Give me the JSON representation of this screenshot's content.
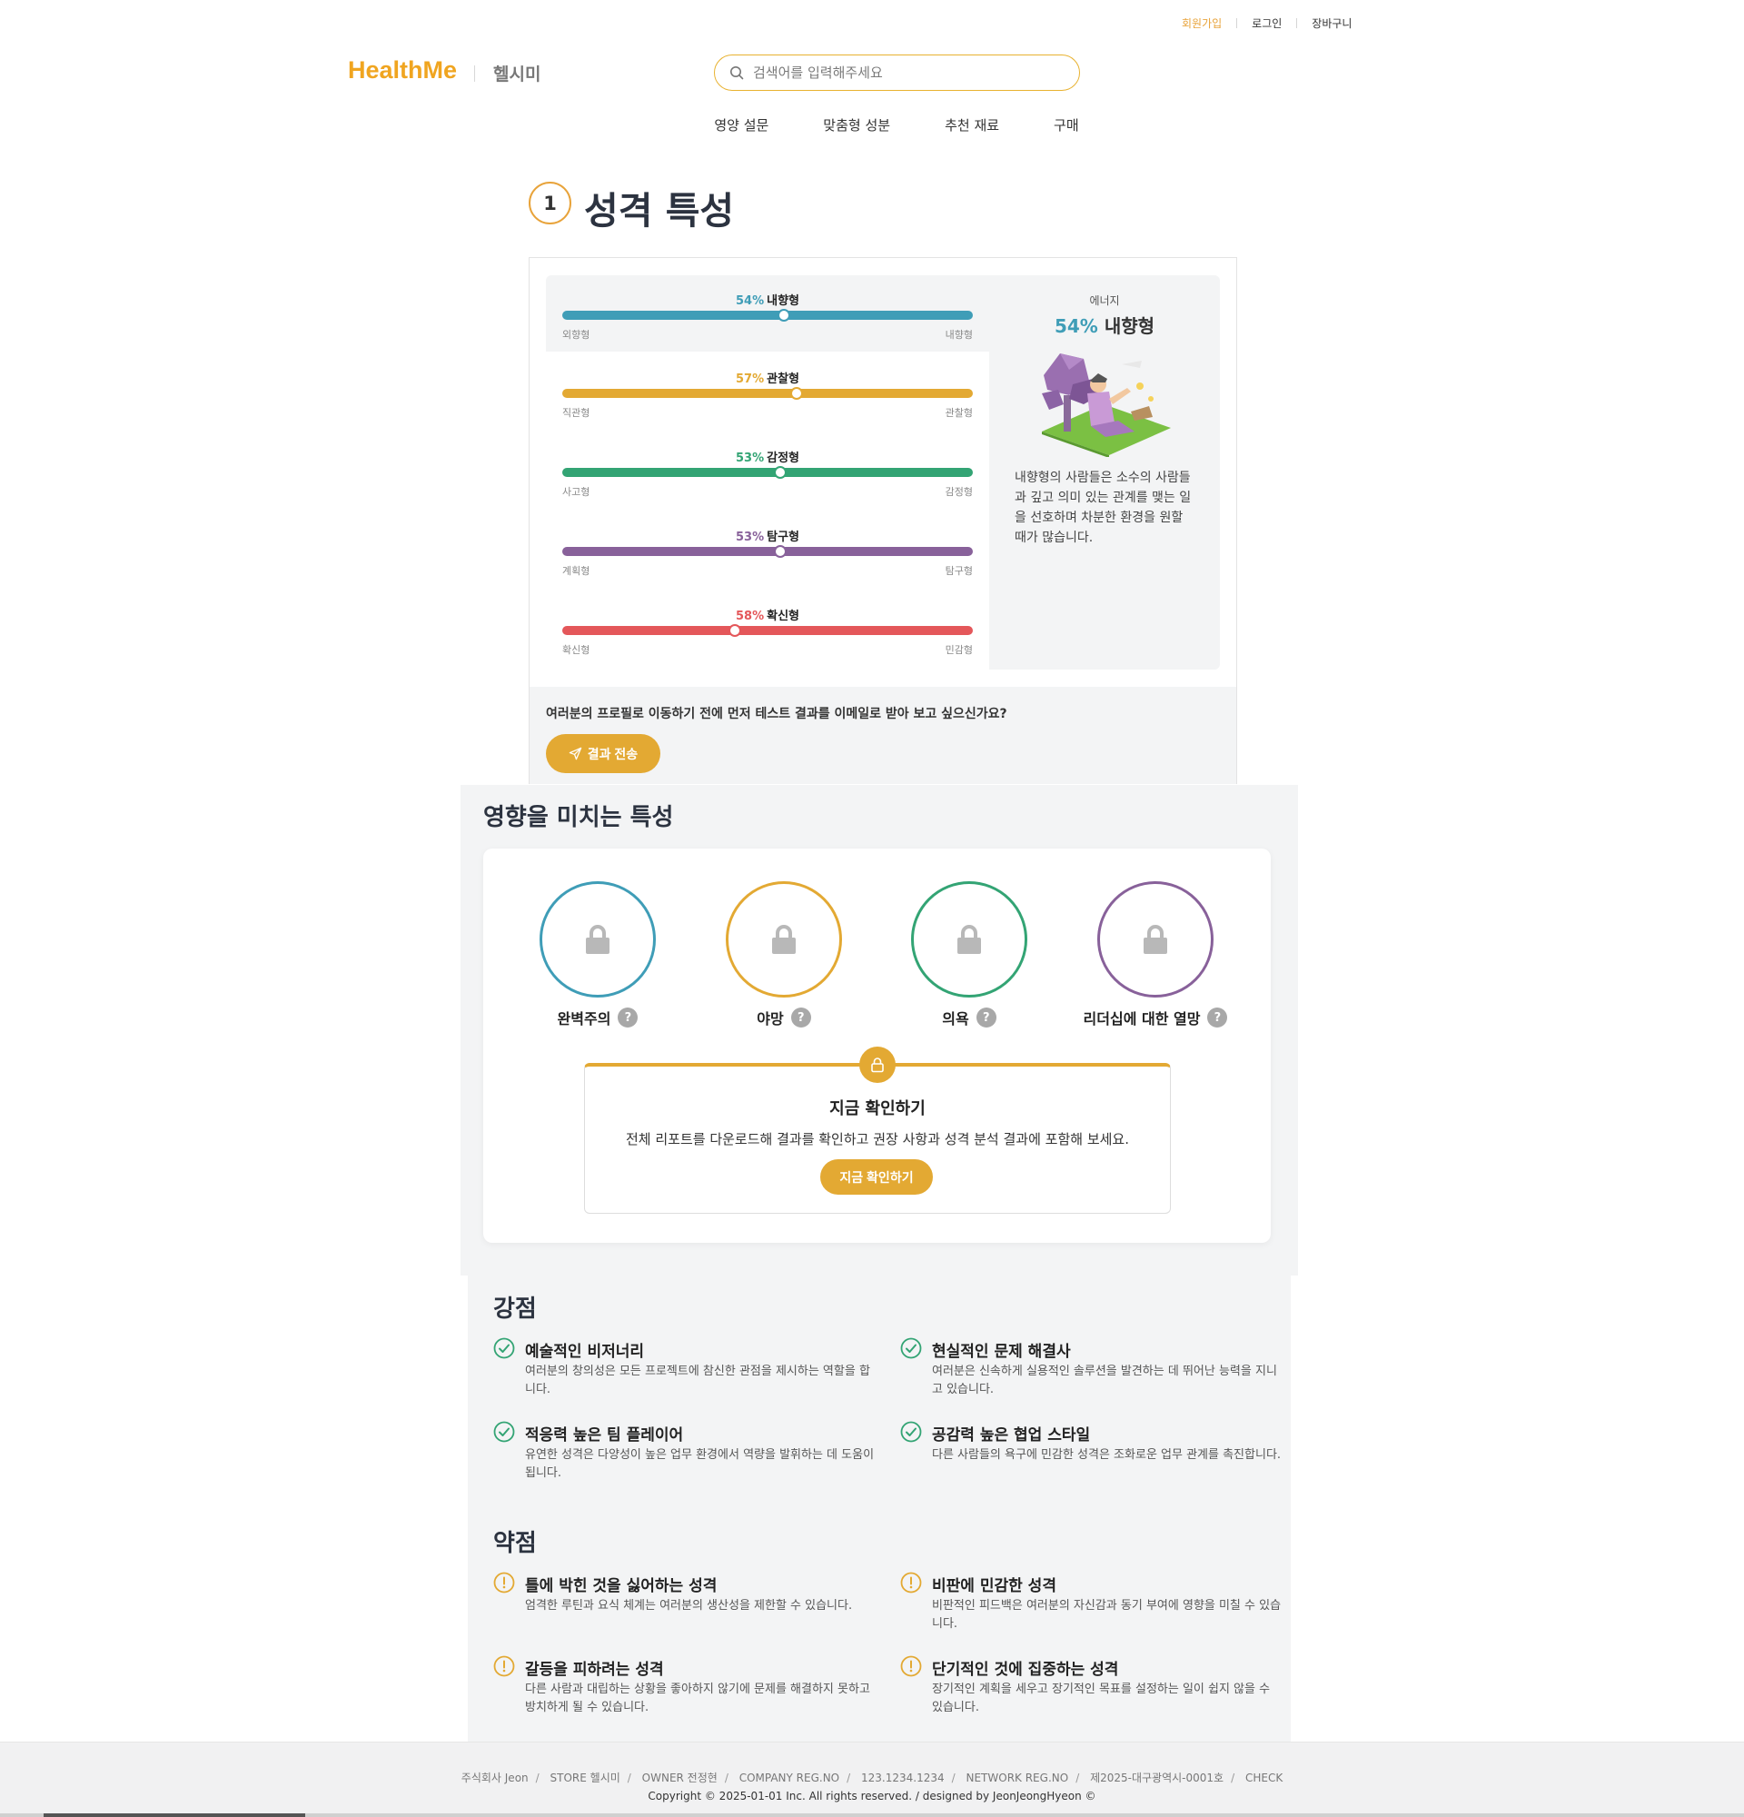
{
  "header": {
    "util": {
      "signup": "회원가입",
      "login": "로그인",
      "cart": "장바구니"
    },
    "logo": "HealthMe",
    "logo_sub": "헬시미",
    "search_placeholder": "검색어를 입력해주세요",
    "nav": [
      "영양 설문",
      "맞춤형 성분",
      "추천 재료",
      "구매"
    ]
  },
  "section1": {
    "step": "1",
    "title": "성격 특성",
    "traits": [
      {
        "pct": "54%",
        "name": "내향형",
        "left": "외향형",
        "right": "내향형",
        "value": 0.54,
        "color": "#3f9db7"
      },
      {
        "pct": "57%",
        "name": "관찰형",
        "left": "직관형",
        "right": "관찰형",
        "value": 0.57,
        "color": "#e3a933"
      },
      {
        "pct": "53%",
        "name": "감정형",
        "left": "사고형",
        "right": "감정형",
        "value": 0.53,
        "color": "#33a474"
      },
      {
        "pct": "53%",
        "name": "탐구형",
        "left": "계획형",
        "right": "탐구형",
        "value": 0.53,
        "color": "#88619a"
      },
      {
        "pct": "58%",
        "name": "확신형",
        "left": "확신형",
        "right": "민감형",
        "value": 0.42,
        "color": "#e4575a"
      }
    ],
    "detail": {
      "category": "에너지",
      "pct": "54%",
      "name": "내향형",
      "description": "내향형의 사람들은 소수의 사람들과 깊고 의미 있는 관계를 맺는 일을 선호하며 차분한 환경을 원할 때가 많습니다."
    },
    "email_question": "여러분의 프로필로 이동하기 전에 먼저 테스트 결과를 이메일로 받아 보고 싶으신가요?",
    "email_button": "결과 전송"
  },
  "section2": {
    "title": "영향을 미치는 특성",
    "items": [
      {
        "name": "완벽주의",
        "color": "#3f9db7"
      },
      {
        "name": "야망",
        "color": "#e3a933"
      },
      {
        "name": "의욕",
        "color": "#33a474"
      },
      {
        "name": "리더십에 대한 열망",
        "color": "#88619a"
      }
    ],
    "help": "?",
    "unlock_title": "지금 확인하기",
    "unlock_desc": "전체 리포트를 다운로드해 결과를 확인하고 권장 사항과 성격 분석 결과에 포함해 보세요.",
    "unlock_button": "지금 확인하기"
  },
  "strengths": {
    "title": "강점",
    "items": [
      {
        "title": "예술적인 비저너리",
        "desc": "여러분의 창의성은 모든 프로젝트에 참신한 관점을 제시하는 역할을 합니다."
      },
      {
        "title": "현실적인 문제 해결사",
        "desc": "여러분은 신속하게 실용적인 솔루션을 발견하는 데 뛰어난 능력을 지니고 있습니다."
      },
      {
        "title": "적응력 높은 팀 플레이어",
        "desc": "유연한 성격은 다양성이 높은 업무 환경에서 역량을 발휘하는 데 도움이 됩니다."
      },
      {
        "title": "공감력 높은 협업 스타일",
        "desc": "다른 사람들의 욕구에 민감한 성격은 조화로운 업무 관계를 촉진합니다."
      }
    ]
  },
  "weaknesses": {
    "title": "약점",
    "items": [
      {
        "title": "틀에 박힌 것을 싫어하는 성격",
        "desc": "엄격한 루틴과 요식 체계는 여러분의 생산성을 제한할 수 있습니다."
      },
      {
        "title": "비판에 민감한 성격",
        "desc": "비판적인 피드백은 여러분의 자신감과 동기 부여에 영향을 미칠 수 있습니다."
      },
      {
        "title": "갈등을 피하려는 성격",
        "desc": "다른 사람과 대립하는 상황을 좋아하지 않기에 문제를 해결하지 못하고 방치하게 될 수 있습니다."
      },
      {
        "title": "단기적인 것에 집중하는 성격",
        "desc": "장기적인 계획을 세우고 장기적인 목표를 설정하는 일이 쉽지 않을 수 있습니다."
      }
    ]
  },
  "footer": {
    "info": [
      "주식회사 Jeon",
      "STORE 헬시미",
      "OWNER 전정현",
      "COMPANY REG.NO",
      "123.1234.1234",
      "NETWORK REG.NO",
      "제2025-대구광역시-0001호",
      "CHECK"
    ],
    "separator": "/",
    "copyright": "Copyright © 2025-01-01 Inc. All rights reserved. / designed by JeonJeongHyeon ©"
  },
  "colors": {
    "accent": "#e3a933",
    "logo": "#f0a520"
  }
}
